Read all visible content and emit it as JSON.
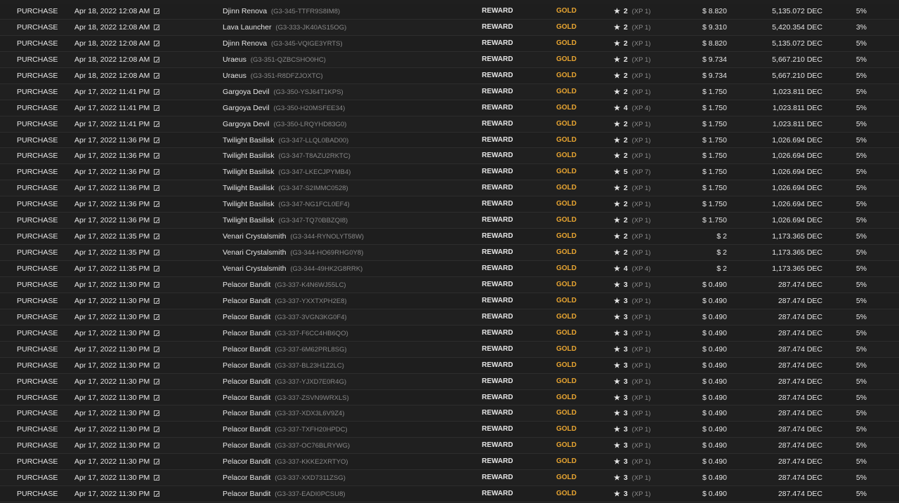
{
  "rows": [
    {
      "type": "PURCHASE",
      "date": "Apr 18, 2022 12:08 AM",
      "card": "Djinn Renova",
      "id": "(G3-345-TTFR9S8IM8)",
      "edition": "REWARD",
      "foil": "GOLD",
      "level": "2",
      "xp": "(XP 1)",
      "price": "$ 8.820",
      "dec": "5,135.072 DEC",
      "fee": "5%"
    },
    {
      "type": "PURCHASE",
      "date": "Apr 18, 2022 12:08 AM",
      "card": "Lava Launcher",
      "id": "(G3-333-JK40AS15OG)",
      "edition": "REWARD",
      "foil": "GOLD",
      "level": "2",
      "xp": "(XP 1)",
      "price": "$ 9.310",
      "dec": "5,420.354 DEC",
      "fee": "3%"
    },
    {
      "type": "PURCHASE",
      "date": "Apr 18, 2022 12:08 AM",
      "card": "Djinn Renova",
      "id": "(G3-345-VQIGE3YRTS)",
      "edition": "REWARD",
      "foil": "GOLD",
      "level": "2",
      "xp": "(XP 1)",
      "price": "$ 8.820",
      "dec": "5,135.072 DEC",
      "fee": "5%"
    },
    {
      "type": "PURCHASE",
      "date": "Apr 18, 2022 12:08 AM",
      "card": "Uraeus",
      "id": "(G3-351-QZBCSHO0HC)",
      "edition": "REWARD",
      "foil": "GOLD",
      "level": "2",
      "xp": "(XP 1)",
      "price": "$ 9.734",
      "dec": "5,667.210 DEC",
      "fee": "5%"
    },
    {
      "type": "PURCHASE",
      "date": "Apr 18, 2022 12:08 AM",
      "card": "Uraeus",
      "id": "(G3-351-R8DFZJOXTC)",
      "edition": "REWARD",
      "foil": "GOLD",
      "level": "2",
      "xp": "(XP 1)",
      "price": "$ 9.734",
      "dec": "5,667.210 DEC",
      "fee": "5%"
    },
    {
      "type": "PURCHASE",
      "date": "Apr 17, 2022 11:41 PM",
      "card": "Gargoya Devil",
      "id": "(G3-350-YSJ64T1KPS)",
      "edition": "REWARD",
      "foil": "GOLD",
      "level": "2",
      "xp": "(XP 1)",
      "price": "$ 1.750",
      "dec": "1,023.811 DEC",
      "fee": "5%"
    },
    {
      "type": "PURCHASE",
      "date": "Apr 17, 2022 11:41 PM",
      "card": "Gargoya Devil",
      "id": "(G3-350-H20MSFEE34)",
      "edition": "REWARD",
      "foil": "GOLD",
      "level": "4",
      "xp": "(XP 4)",
      "price": "$ 1.750",
      "dec": "1,023.811 DEC",
      "fee": "5%"
    },
    {
      "type": "PURCHASE",
      "date": "Apr 17, 2022 11:41 PM",
      "card": "Gargoya Devil",
      "id": "(G3-350-LRQYHD83G0)",
      "edition": "REWARD",
      "foil": "GOLD",
      "level": "2",
      "xp": "(XP 1)",
      "price": "$ 1.750",
      "dec": "1,023.811 DEC",
      "fee": "5%"
    },
    {
      "type": "PURCHASE",
      "date": "Apr 17, 2022 11:36 PM",
      "card": "Twilight Basilisk",
      "id": "(G3-347-LLQL0BAD00)",
      "edition": "REWARD",
      "foil": "GOLD",
      "level": "2",
      "xp": "(XP 1)",
      "price": "$ 1.750",
      "dec": "1,026.694 DEC",
      "fee": "5%"
    },
    {
      "type": "PURCHASE",
      "date": "Apr 17, 2022 11:36 PM",
      "card": "Twilight Basilisk",
      "id": "(G3-347-T8AZU2RKTC)",
      "edition": "REWARD",
      "foil": "GOLD",
      "level": "2",
      "xp": "(XP 1)",
      "price": "$ 1.750",
      "dec": "1,026.694 DEC",
      "fee": "5%"
    },
    {
      "type": "PURCHASE",
      "date": "Apr 17, 2022 11:36 PM",
      "card": "Twilight Basilisk",
      "id": "(G3-347-LKECJPYMB4)",
      "edition": "REWARD",
      "foil": "GOLD",
      "level": "5",
      "xp": "(XP 7)",
      "price": "$ 1.750",
      "dec": "1,026.694 DEC",
      "fee": "5%"
    },
    {
      "type": "PURCHASE",
      "date": "Apr 17, 2022 11:36 PM",
      "card": "Twilight Basilisk",
      "id": "(G3-347-S2IMMC0528)",
      "edition": "REWARD",
      "foil": "GOLD",
      "level": "2",
      "xp": "(XP 1)",
      "price": "$ 1.750",
      "dec": "1,026.694 DEC",
      "fee": "5%"
    },
    {
      "type": "PURCHASE",
      "date": "Apr 17, 2022 11:36 PM",
      "card": "Twilight Basilisk",
      "id": "(G3-347-NG1FCL0EF4)",
      "edition": "REWARD",
      "foil": "GOLD",
      "level": "2",
      "xp": "(XP 1)",
      "price": "$ 1.750",
      "dec": "1,026.694 DEC",
      "fee": "5%"
    },
    {
      "type": "PURCHASE",
      "date": "Apr 17, 2022 11:36 PM",
      "card": "Twilight Basilisk",
      "id": "(G3-347-TQ70BBZQI8)",
      "edition": "REWARD",
      "foil": "GOLD",
      "level": "2",
      "xp": "(XP 1)",
      "price": "$ 1.750",
      "dec": "1,026.694 DEC",
      "fee": "5%"
    },
    {
      "type": "PURCHASE",
      "date": "Apr 17, 2022 11:35 PM",
      "card": "Venari Crystalsmith",
      "id": "(G3-344-RYNOLYT58W)",
      "edition": "REWARD",
      "foil": "GOLD",
      "level": "2",
      "xp": "(XP 1)",
      "price": "$ 2",
      "dec": "1,173.365 DEC",
      "fee": "5%"
    },
    {
      "type": "PURCHASE",
      "date": "Apr 17, 2022 11:35 PM",
      "card": "Venari Crystalsmith",
      "id": "(G3-344-HO69RHG0Y8)",
      "edition": "REWARD",
      "foil": "GOLD",
      "level": "2",
      "xp": "(XP 1)",
      "price": "$ 2",
      "dec": "1,173.365 DEC",
      "fee": "5%"
    },
    {
      "type": "PURCHASE",
      "date": "Apr 17, 2022 11:35 PM",
      "card": "Venari Crystalsmith",
      "id": "(G3-344-49HK2G8RRK)",
      "edition": "REWARD",
      "foil": "GOLD",
      "level": "4",
      "xp": "(XP 4)",
      "price": "$ 2",
      "dec": "1,173.365 DEC",
      "fee": "5%"
    },
    {
      "type": "PURCHASE",
      "date": "Apr 17, 2022 11:30 PM",
      "card": "Pelacor Bandit",
      "id": "(G3-337-K4N6WJ55LC)",
      "edition": "REWARD",
      "foil": "GOLD",
      "level": "3",
      "xp": "(XP 1)",
      "price": "$ 0.490",
      "dec": "287.474 DEC",
      "fee": "5%"
    },
    {
      "type": "PURCHASE",
      "date": "Apr 17, 2022 11:30 PM",
      "card": "Pelacor Bandit",
      "id": "(G3-337-YXXTXPH2E8)",
      "edition": "REWARD",
      "foil": "GOLD",
      "level": "3",
      "xp": "(XP 1)",
      "price": "$ 0.490",
      "dec": "287.474 DEC",
      "fee": "5%"
    },
    {
      "type": "PURCHASE",
      "date": "Apr 17, 2022 11:30 PM",
      "card": "Pelacor Bandit",
      "id": "(G3-337-3VGN3KG0F4)",
      "edition": "REWARD",
      "foil": "GOLD",
      "level": "3",
      "xp": "(XP 1)",
      "price": "$ 0.490",
      "dec": "287.474 DEC",
      "fee": "5%"
    },
    {
      "type": "PURCHASE",
      "date": "Apr 17, 2022 11:30 PM",
      "card": "Pelacor Bandit",
      "id": "(G3-337-F6CC4HB6QO)",
      "edition": "REWARD",
      "foil": "GOLD",
      "level": "3",
      "xp": "(XP 1)",
      "price": "$ 0.490",
      "dec": "287.474 DEC",
      "fee": "5%"
    },
    {
      "type": "PURCHASE",
      "date": "Apr 17, 2022 11:30 PM",
      "card": "Pelacor Bandit",
      "id": "(G3-337-6M62PRL8SG)",
      "edition": "REWARD",
      "foil": "GOLD",
      "level": "3",
      "xp": "(XP 1)",
      "price": "$ 0.490",
      "dec": "287.474 DEC",
      "fee": "5%"
    },
    {
      "type": "PURCHASE",
      "date": "Apr 17, 2022 11:30 PM",
      "card": "Pelacor Bandit",
      "id": "(G3-337-BL23H1Z2LC)",
      "edition": "REWARD",
      "foil": "GOLD",
      "level": "3",
      "xp": "(XP 1)",
      "price": "$ 0.490",
      "dec": "287.474 DEC",
      "fee": "5%"
    },
    {
      "type": "PURCHASE",
      "date": "Apr 17, 2022 11:30 PM",
      "card": "Pelacor Bandit",
      "id": "(G3-337-YJXD7E0R4G)",
      "edition": "REWARD",
      "foil": "GOLD",
      "level": "3",
      "xp": "(XP 1)",
      "price": "$ 0.490",
      "dec": "287.474 DEC",
      "fee": "5%"
    },
    {
      "type": "PURCHASE",
      "date": "Apr 17, 2022 11:30 PM",
      "card": "Pelacor Bandit",
      "id": "(G3-337-ZSVN9WRXLS)",
      "edition": "REWARD",
      "foil": "GOLD",
      "level": "3",
      "xp": "(XP 1)",
      "price": "$ 0.490",
      "dec": "287.474 DEC",
      "fee": "5%"
    },
    {
      "type": "PURCHASE",
      "date": "Apr 17, 2022 11:30 PM",
      "card": "Pelacor Bandit",
      "id": "(G3-337-XDX3L6V9Z4)",
      "edition": "REWARD",
      "foil": "GOLD",
      "level": "3",
      "xp": "(XP 1)",
      "price": "$ 0.490",
      "dec": "287.474 DEC",
      "fee": "5%"
    },
    {
      "type": "PURCHASE",
      "date": "Apr 17, 2022 11:30 PM",
      "card": "Pelacor Bandit",
      "id": "(G3-337-TXFH20HPDC)",
      "edition": "REWARD",
      "foil": "GOLD",
      "level": "3",
      "xp": "(XP 1)",
      "price": "$ 0.490",
      "dec": "287.474 DEC",
      "fee": "5%"
    },
    {
      "type": "PURCHASE",
      "date": "Apr 17, 2022 11:30 PM",
      "card": "Pelacor Bandit",
      "id": "(G3-337-OC76BLRYWG)",
      "edition": "REWARD",
      "foil": "GOLD",
      "level": "3",
      "xp": "(XP 1)",
      "price": "$ 0.490",
      "dec": "287.474 DEC",
      "fee": "5%"
    },
    {
      "type": "PURCHASE",
      "date": "Apr 17, 2022 11:30 PM",
      "card": "Pelacor Bandit",
      "id": "(G3-337-KKKE2XRTYO)",
      "edition": "REWARD",
      "foil": "GOLD",
      "level": "3",
      "xp": "(XP 1)",
      "price": "$ 0.490",
      "dec": "287.474 DEC",
      "fee": "5%"
    },
    {
      "type": "PURCHASE",
      "date": "Apr 17, 2022 11:30 PM",
      "card": "Pelacor Bandit",
      "id": "(G3-337-XXD7311ZSG)",
      "edition": "REWARD",
      "foil": "GOLD",
      "level": "3",
      "xp": "(XP 1)",
      "price": "$ 0.490",
      "dec": "287.474 DEC",
      "fee": "5%"
    },
    {
      "type": "PURCHASE",
      "date": "Apr 17, 2022 11:30 PM",
      "card": "Pelacor Bandit",
      "id": "(G3-337-EADI0PCSU8)",
      "edition": "REWARD",
      "foil": "GOLD",
      "level": "3",
      "xp": "(XP 1)",
      "price": "$ 0.490",
      "dec": "287.474 DEC",
      "fee": "5%"
    }
  ],
  "icons": {
    "date_link": "external-link-icon",
    "level": "star-icon"
  },
  "colors": {
    "background": "#1f1f1f",
    "text": "#e6e6e6",
    "gold": "#e8a531",
    "muted": "#8a8a8a"
  }
}
